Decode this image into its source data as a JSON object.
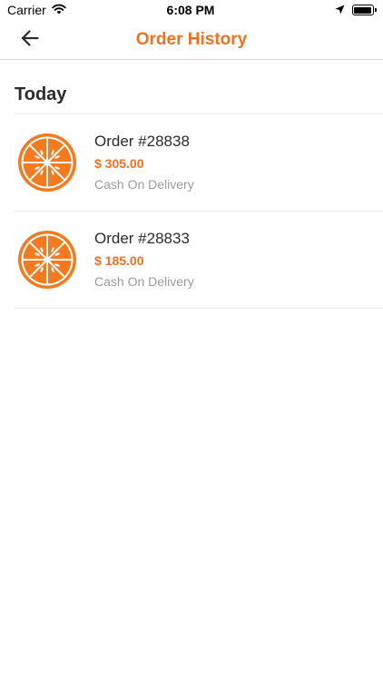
{
  "status_bar": {
    "carrier": "Carrier",
    "time": "6:08 PM"
  },
  "header": {
    "title": "Order History",
    "back_icon": "arrow-left-icon"
  },
  "sections": [
    {
      "title": "Today",
      "orders": [
        {
          "number": "Order #28838",
          "price": "$ 305.00",
          "payment": "Cash On Delivery",
          "thumb_icon": "orange-slice-icon"
        },
        {
          "number": "Order #28833",
          "price": "$ 185.00",
          "payment": "Cash On Delivery",
          "thumb_icon": "orange-slice-icon"
        }
      ]
    }
  ],
  "colors": {
    "accent": "#f07121",
    "muted": "#9b9b9b",
    "text": "#2b2b2b"
  }
}
